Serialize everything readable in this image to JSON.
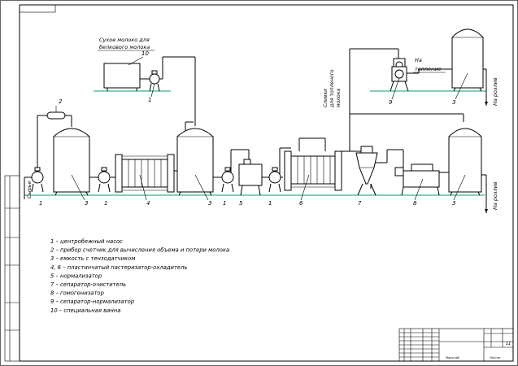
{
  "labels": {
    "dry_milk": "Сухое молоко для",
    "dry_milk2": "белкового молока",
    "cream_to": "Сливки",
    "cream_to2": "для топленого",
    "cream_to3": "молока",
    "to_melt": "На",
    "to_melt2": "топление",
    "raw_milk": "Сырье",
    "to_bottling": "На розлив"
  },
  "numbers": {
    "n1": "1",
    "n2": "2",
    "n3": "3",
    "n4": "4",
    "n5": "5",
    "n6": "6",
    "n7": "7",
    "n8": "8",
    "n9": "9",
    "n10": "10"
  },
  "legend": [
    "1 – центробежный насос",
    "2 – прибор счетчик для вычисления объема и потери молока",
    "3 – емкость с тензодатчиком",
    "4, 6 – пластинчатый пастеризатор-охладитель",
    "5 – нормализатор",
    "7 – сепаратор-очиститель",
    "8 – гомогенизатор",
    "9 – сепаратор-нормализатор",
    "10 – специальная ванна"
  ],
  "stamp": {
    "sheet": "Лист",
    "sheets": "Листов",
    "sheet_num": "11",
    "scale": "Масштаб"
  }
}
